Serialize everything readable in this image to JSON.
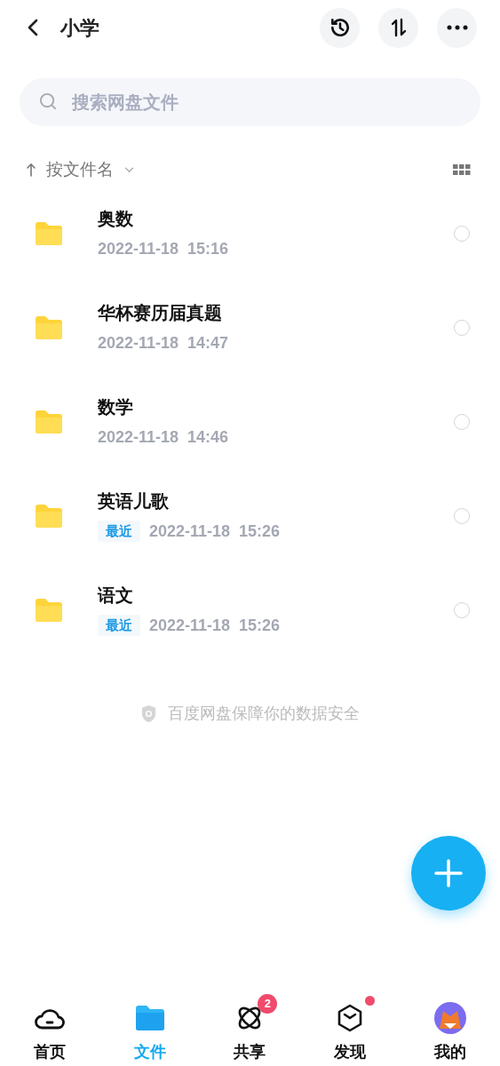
{
  "header": {
    "title": "小学"
  },
  "search": {
    "placeholder": "搜索网盘文件"
  },
  "sort": {
    "label": "按文件名"
  },
  "files": [
    {
      "name": "奥数",
      "date": "2022-11-18  15:16",
      "selected": false
    },
    {
      "name": "华杯赛历届真题",
      "date": "2022-11-18  14:47",
      "selected": false
    },
    {
      "name": "数学",
      "date": "2022-11-18  14:46",
      "selected": false
    },
    {
      "name": "英语儿歌",
      "tag": "最近",
      "date": "2022-11-18  15:26",
      "selected": false
    },
    {
      "name": "语文",
      "tag": "最近",
      "date": "2022-11-18  15:26",
      "selected": false
    }
  ],
  "footer_note": "百度网盘保障你的数据安全",
  "tabs": [
    {
      "kind": "home",
      "label": "首页",
      "selected": false
    },
    {
      "kind": "files",
      "label": "文件",
      "selected": true
    },
    {
      "kind": "share",
      "label": "共享",
      "selected": false,
      "badge": "2"
    },
    {
      "kind": "discover",
      "label": "发现",
      "selected": false,
      "dot": true
    },
    {
      "kind": "mine",
      "label": "我的",
      "selected": false
    }
  ]
}
